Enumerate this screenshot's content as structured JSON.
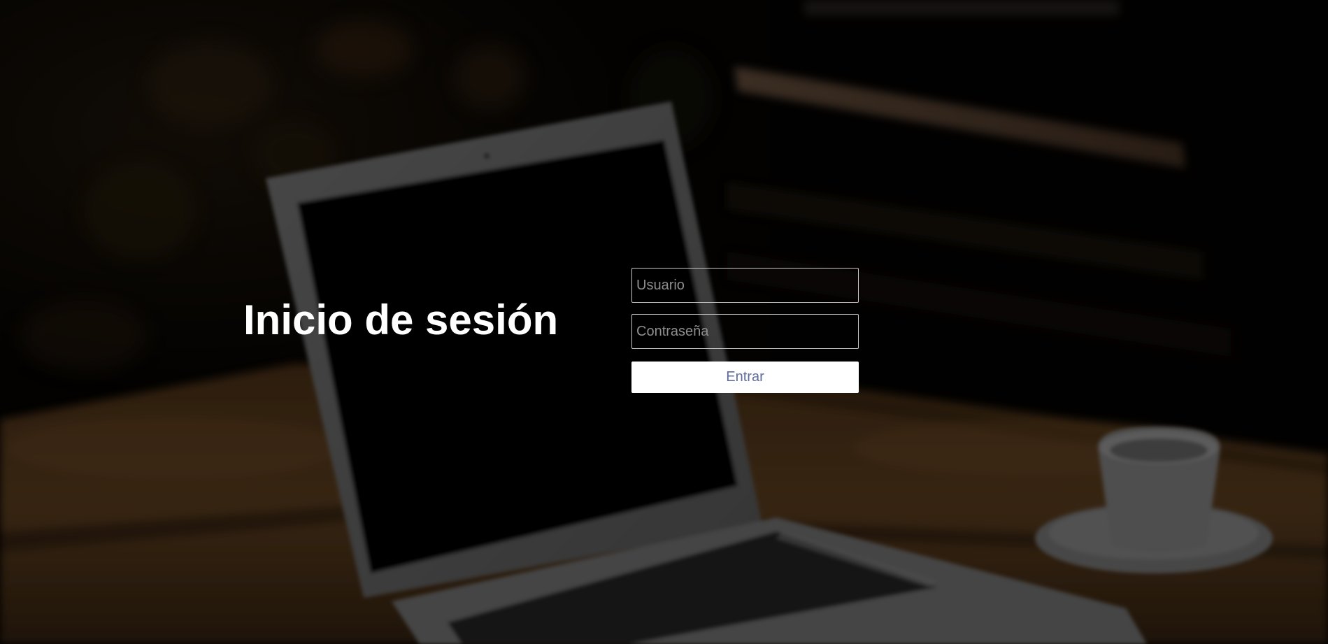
{
  "login": {
    "title": "Inicio de sesión",
    "username_placeholder": "Usuario",
    "password_placeholder": "Contraseña",
    "submit_label": "Entrar"
  },
  "colors": {
    "title": "#ffffff",
    "button_background": "#ffffff",
    "button_text": "#5f6b9a",
    "field_border": "#c9c9c9",
    "placeholder": "#8e8e8e"
  }
}
